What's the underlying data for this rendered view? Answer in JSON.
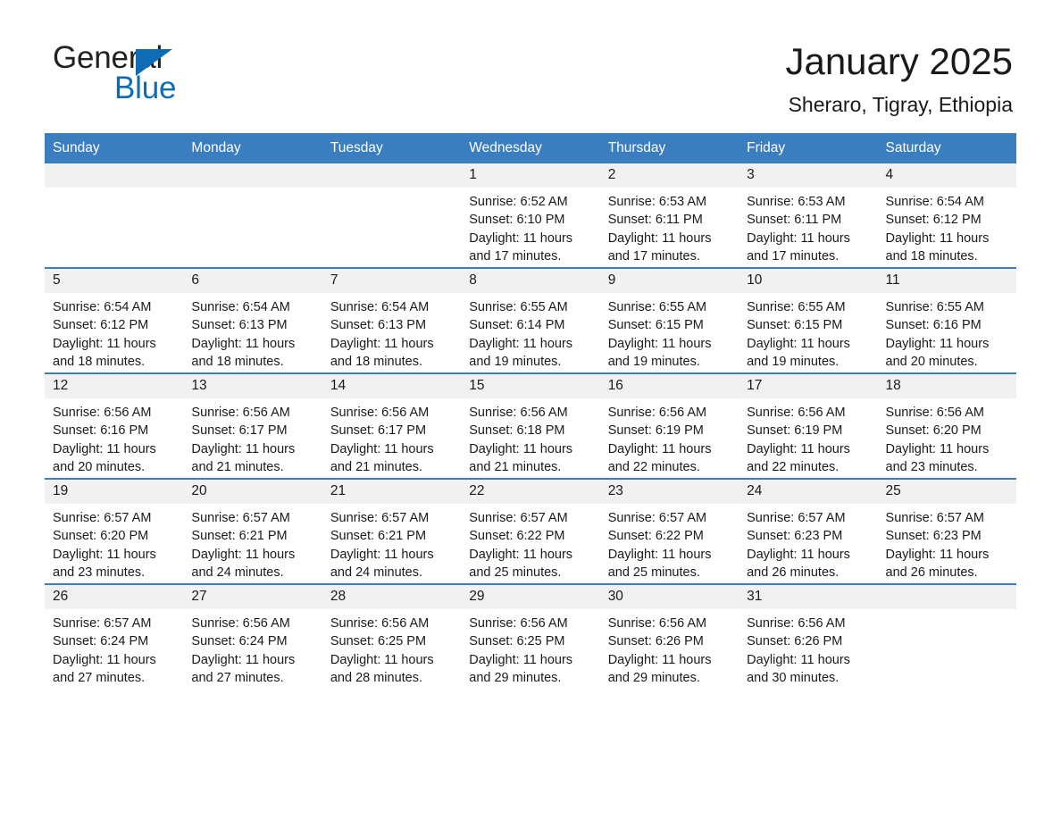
{
  "brand": {
    "name_part1": "General",
    "name_part2": "Blue",
    "accent_color": "#0d6cb4"
  },
  "header": {
    "title": "January 2025",
    "location": "Sheraro, Tigray, Ethiopia"
  },
  "calendar": {
    "header_color": "#3a7ebf",
    "daynum_bg": "#f1f1f1",
    "weekday_headers": [
      "Sunday",
      "Monday",
      "Tuesday",
      "Wednesday",
      "Thursday",
      "Friday",
      "Saturday"
    ],
    "weeks": [
      [
        {
          "day": "",
          "sunrise": "",
          "sunset": "",
          "daylight_line1": "",
          "daylight_line2": ""
        },
        {
          "day": "",
          "sunrise": "",
          "sunset": "",
          "daylight_line1": "",
          "daylight_line2": ""
        },
        {
          "day": "",
          "sunrise": "",
          "sunset": "",
          "daylight_line1": "",
          "daylight_line2": ""
        },
        {
          "day": "1",
          "sunrise": "Sunrise: 6:52 AM",
          "sunset": "Sunset: 6:10 PM",
          "daylight_line1": "Daylight: 11 hours",
          "daylight_line2": "and 17 minutes."
        },
        {
          "day": "2",
          "sunrise": "Sunrise: 6:53 AM",
          "sunset": "Sunset: 6:11 PM",
          "daylight_line1": "Daylight: 11 hours",
          "daylight_line2": "and 17 minutes."
        },
        {
          "day": "3",
          "sunrise": "Sunrise: 6:53 AM",
          "sunset": "Sunset: 6:11 PM",
          "daylight_line1": "Daylight: 11 hours",
          "daylight_line2": "and 17 minutes."
        },
        {
          "day": "4",
          "sunrise": "Sunrise: 6:54 AM",
          "sunset": "Sunset: 6:12 PM",
          "daylight_line1": "Daylight: 11 hours",
          "daylight_line2": "and 18 minutes."
        }
      ],
      [
        {
          "day": "5",
          "sunrise": "Sunrise: 6:54 AM",
          "sunset": "Sunset: 6:12 PM",
          "daylight_line1": "Daylight: 11 hours",
          "daylight_line2": "and 18 minutes."
        },
        {
          "day": "6",
          "sunrise": "Sunrise: 6:54 AM",
          "sunset": "Sunset: 6:13 PM",
          "daylight_line1": "Daylight: 11 hours",
          "daylight_line2": "and 18 minutes."
        },
        {
          "day": "7",
          "sunrise": "Sunrise: 6:54 AM",
          "sunset": "Sunset: 6:13 PM",
          "daylight_line1": "Daylight: 11 hours",
          "daylight_line2": "and 18 minutes."
        },
        {
          "day": "8",
          "sunrise": "Sunrise: 6:55 AM",
          "sunset": "Sunset: 6:14 PM",
          "daylight_line1": "Daylight: 11 hours",
          "daylight_line2": "and 19 minutes."
        },
        {
          "day": "9",
          "sunrise": "Sunrise: 6:55 AM",
          "sunset": "Sunset: 6:15 PM",
          "daylight_line1": "Daylight: 11 hours",
          "daylight_line2": "and 19 minutes."
        },
        {
          "day": "10",
          "sunrise": "Sunrise: 6:55 AM",
          "sunset": "Sunset: 6:15 PM",
          "daylight_line1": "Daylight: 11 hours",
          "daylight_line2": "and 19 minutes."
        },
        {
          "day": "11",
          "sunrise": "Sunrise: 6:55 AM",
          "sunset": "Sunset: 6:16 PM",
          "daylight_line1": "Daylight: 11 hours",
          "daylight_line2": "and 20 minutes."
        }
      ],
      [
        {
          "day": "12",
          "sunrise": "Sunrise: 6:56 AM",
          "sunset": "Sunset: 6:16 PM",
          "daylight_line1": "Daylight: 11 hours",
          "daylight_line2": "and 20 minutes."
        },
        {
          "day": "13",
          "sunrise": "Sunrise: 6:56 AM",
          "sunset": "Sunset: 6:17 PM",
          "daylight_line1": "Daylight: 11 hours",
          "daylight_line2": "and 21 minutes."
        },
        {
          "day": "14",
          "sunrise": "Sunrise: 6:56 AM",
          "sunset": "Sunset: 6:17 PM",
          "daylight_line1": "Daylight: 11 hours",
          "daylight_line2": "and 21 minutes."
        },
        {
          "day": "15",
          "sunrise": "Sunrise: 6:56 AM",
          "sunset": "Sunset: 6:18 PM",
          "daylight_line1": "Daylight: 11 hours",
          "daylight_line2": "and 21 minutes."
        },
        {
          "day": "16",
          "sunrise": "Sunrise: 6:56 AM",
          "sunset": "Sunset: 6:19 PM",
          "daylight_line1": "Daylight: 11 hours",
          "daylight_line2": "and 22 minutes."
        },
        {
          "day": "17",
          "sunrise": "Sunrise: 6:56 AM",
          "sunset": "Sunset: 6:19 PM",
          "daylight_line1": "Daylight: 11 hours",
          "daylight_line2": "and 22 minutes."
        },
        {
          "day": "18",
          "sunrise": "Sunrise: 6:56 AM",
          "sunset": "Sunset: 6:20 PM",
          "daylight_line1": "Daylight: 11 hours",
          "daylight_line2": "and 23 minutes."
        }
      ],
      [
        {
          "day": "19",
          "sunrise": "Sunrise: 6:57 AM",
          "sunset": "Sunset: 6:20 PM",
          "daylight_line1": "Daylight: 11 hours",
          "daylight_line2": "and 23 minutes."
        },
        {
          "day": "20",
          "sunrise": "Sunrise: 6:57 AM",
          "sunset": "Sunset: 6:21 PM",
          "daylight_line1": "Daylight: 11 hours",
          "daylight_line2": "and 24 minutes."
        },
        {
          "day": "21",
          "sunrise": "Sunrise: 6:57 AM",
          "sunset": "Sunset: 6:21 PM",
          "daylight_line1": "Daylight: 11 hours",
          "daylight_line2": "and 24 minutes."
        },
        {
          "day": "22",
          "sunrise": "Sunrise: 6:57 AM",
          "sunset": "Sunset: 6:22 PM",
          "daylight_line1": "Daylight: 11 hours",
          "daylight_line2": "and 25 minutes."
        },
        {
          "day": "23",
          "sunrise": "Sunrise: 6:57 AM",
          "sunset": "Sunset: 6:22 PM",
          "daylight_line1": "Daylight: 11 hours",
          "daylight_line2": "and 25 minutes."
        },
        {
          "day": "24",
          "sunrise": "Sunrise: 6:57 AM",
          "sunset": "Sunset: 6:23 PM",
          "daylight_line1": "Daylight: 11 hours",
          "daylight_line2": "and 26 minutes."
        },
        {
          "day": "25",
          "sunrise": "Sunrise: 6:57 AM",
          "sunset": "Sunset: 6:23 PM",
          "daylight_line1": "Daylight: 11 hours",
          "daylight_line2": "and 26 minutes."
        }
      ],
      [
        {
          "day": "26",
          "sunrise": "Sunrise: 6:57 AM",
          "sunset": "Sunset: 6:24 PM",
          "daylight_line1": "Daylight: 11 hours",
          "daylight_line2": "and 27 minutes."
        },
        {
          "day": "27",
          "sunrise": "Sunrise: 6:56 AM",
          "sunset": "Sunset: 6:24 PM",
          "daylight_line1": "Daylight: 11 hours",
          "daylight_line2": "and 27 minutes."
        },
        {
          "day": "28",
          "sunrise": "Sunrise: 6:56 AM",
          "sunset": "Sunset: 6:25 PM",
          "daylight_line1": "Daylight: 11 hours",
          "daylight_line2": "and 28 minutes."
        },
        {
          "day": "29",
          "sunrise": "Sunrise: 6:56 AM",
          "sunset": "Sunset: 6:25 PM",
          "daylight_line1": "Daylight: 11 hours",
          "daylight_line2": "and 29 minutes."
        },
        {
          "day": "30",
          "sunrise": "Sunrise: 6:56 AM",
          "sunset": "Sunset: 6:26 PM",
          "daylight_line1": "Daylight: 11 hours",
          "daylight_line2": "and 29 minutes."
        },
        {
          "day": "31",
          "sunrise": "Sunrise: 6:56 AM",
          "sunset": "Sunset: 6:26 PM",
          "daylight_line1": "Daylight: 11 hours",
          "daylight_line2": "and 30 minutes."
        },
        {
          "day": "",
          "sunrise": "",
          "sunset": "",
          "daylight_line1": "",
          "daylight_line2": ""
        }
      ]
    ]
  }
}
